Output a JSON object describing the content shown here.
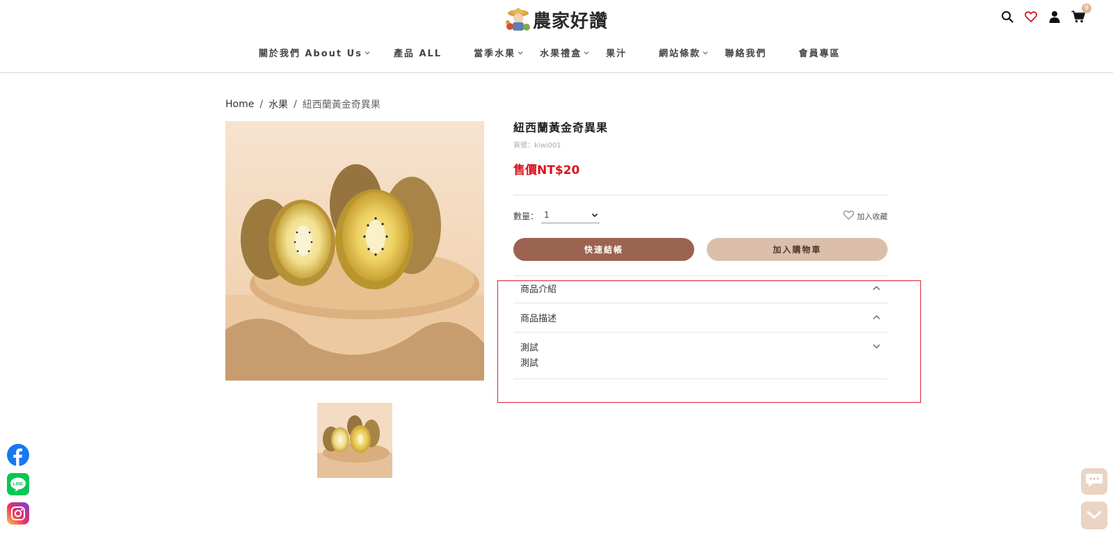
{
  "header": {
    "logo_text": "農家好讚",
    "cart_count": "9",
    "nav": [
      {
        "label": "關於我們 About Us",
        "has_dropdown": true
      },
      {
        "label": "產品 ALL",
        "has_dropdown": false
      },
      {
        "label": "當季水果",
        "has_dropdown": true
      },
      {
        "label": "水果禮盒",
        "has_dropdown": true
      },
      {
        "label": "果汁",
        "has_dropdown": false
      },
      {
        "label": "網站條款",
        "has_dropdown": true
      },
      {
        "label": "聯絡我們",
        "has_dropdown": false
      },
      {
        "label": "會員專區",
        "has_dropdown": false
      }
    ]
  },
  "breadcrumb": {
    "items": [
      "Home",
      "水果",
      "紐西蘭黃金奇異果"
    ],
    "separator": "/"
  },
  "product": {
    "title": "紐西蘭黃金奇異果",
    "sku": "貨號：kiwi001",
    "price": "售價NT$20",
    "quantity_label": "數量：",
    "quantity_value": "1",
    "favorite_label": "加入收藏",
    "checkout_label": "快速結帳",
    "add_to_cart_label": "加入購物車"
  },
  "accordion": [
    {
      "title": "商品介紹",
      "expanded": false,
      "body": ""
    },
    {
      "title": "商品描述",
      "expanded": false,
      "body": ""
    },
    {
      "title": "測試",
      "expanded": true,
      "body": "測試"
    }
  ],
  "colors": {
    "price": "#d9121a",
    "checkout_button": "#9a6451",
    "cart_button": "#dcbfaa",
    "highlight": "#e0202a",
    "badge": "#dcb898"
  },
  "icons": [
    "search-icon",
    "heart-icon",
    "user-icon",
    "cart-icon",
    "facebook-icon",
    "line-icon",
    "instagram-icon",
    "chat-icon",
    "chevron-down-icon"
  ]
}
